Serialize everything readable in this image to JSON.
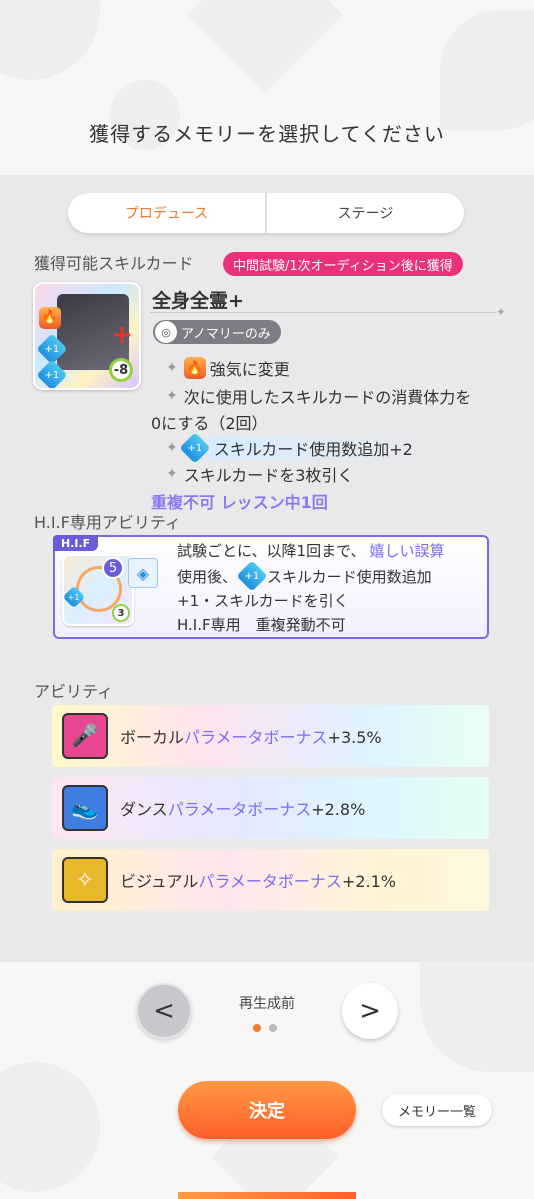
{
  "header": {
    "title": "獲得するメモリーを選択してください"
  },
  "tabs": [
    {
      "label": "プロデュース",
      "active": true
    },
    {
      "label": "ステージ",
      "active": false
    }
  ],
  "skill_section": {
    "label": "獲得可能スキルカード",
    "timing_badge": "中間試験/1次オーディション後に獲得",
    "card": {
      "name": "全身全霊+",
      "cost": "-8",
      "anomaly_badge": "アノマリーのみ",
      "effects": {
        "e1": "強気に変更",
        "e2_line1": "次に使用したスキルカードの消費体力を",
        "e2_line2": "0にする（2回）",
        "e3": "スキルカード使用数追加+2",
        "e4": "スキルカードを3枚引く"
      },
      "restriction": "重複不可 レッスン中1回"
    }
  },
  "hif_section": {
    "label": "H.I.F専用アビリティ",
    "tag": "H.I.F",
    "level": "5",
    "sub_level": "3",
    "line1_pre": "試験ごとに、以降1回まで、",
    "line1_highlight": "嬉しい誤算",
    "line2_pre": "使用後、",
    "line2_post": "スキルカード使用数追加",
    "line3": "+1・スキルカードを引く",
    "line4": "H.I.F専用　重複発動不可"
  },
  "ability_section": {
    "label": "アビリティ",
    "items": [
      {
        "prefix": "ボーカル",
        "highlight": "パラメータボーナス",
        "value": "+3.5%",
        "color": "#e8468f"
      },
      {
        "prefix": "ダンス",
        "highlight": "パラメータボーナス",
        "value": "+2.8%",
        "color": "#3f7ee0"
      },
      {
        "prefix": "ビジュアル",
        "highlight": "パラメータボーナス",
        "value": "+2.1%",
        "color": "#e8b82a"
      }
    ]
  },
  "footer": {
    "page_label": "再生成前",
    "page_total": 2,
    "page_current": 1,
    "decide_label": "決定",
    "memory_list_label": "メモリー一覧"
  }
}
